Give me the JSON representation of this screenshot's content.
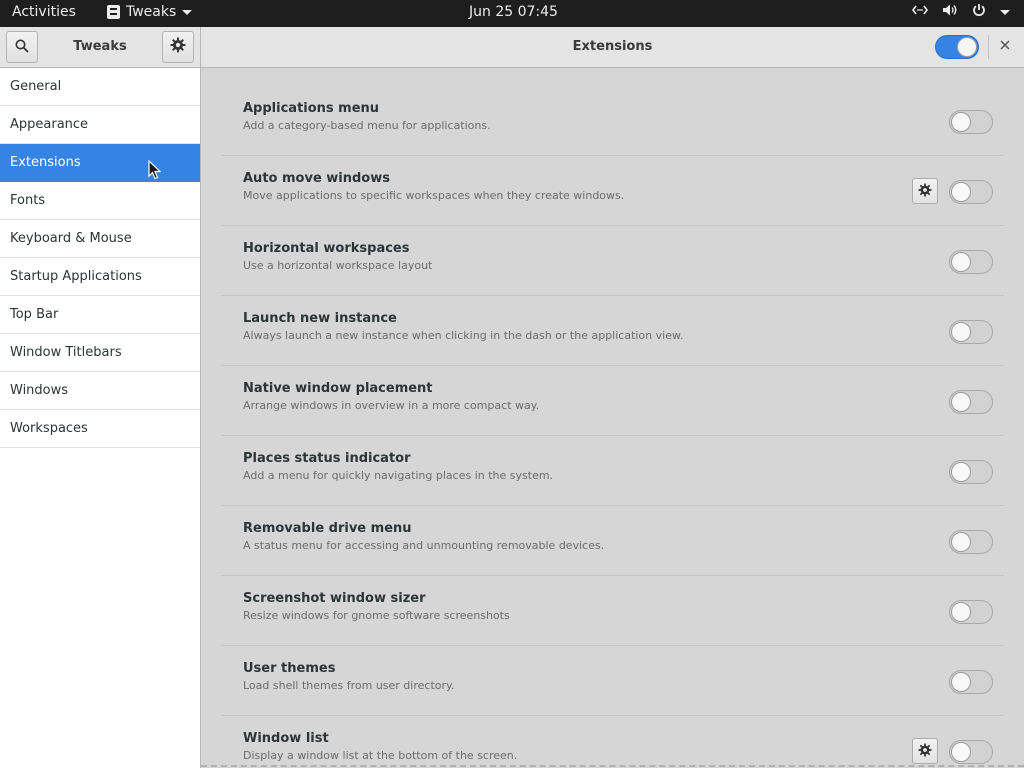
{
  "topbar": {
    "activities": "Activities",
    "app_name": "Tweaks",
    "clock": "Jun 25  07:45"
  },
  "header": {
    "left_title": "Tweaks",
    "main_title": "Extensions",
    "global_switch_on": true
  },
  "sidebar": {
    "items": [
      {
        "label": "General"
      },
      {
        "label": "Appearance"
      },
      {
        "label": "Extensions",
        "active": true
      },
      {
        "label": "Fonts"
      },
      {
        "label": "Keyboard & Mouse"
      },
      {
        "label": "Startup Applications"
      },
      {
        "label": "Top Bar"
      },
      {
        "label": "Window Titlebars"
      },
      {
        "label": "Windows"
      },
      {
        "label": "Workspaces"
      }
    ]
  },
  "extensions": [
    {
      "name": "Applications menu",
      "description": "Add a category-based menu for applications.",
      "has_settings": false,
      "enabled": false
    },
    {
      "name": "Auto move windows",
      "description": "Move applications to specific workspaces when they create windows.",
      "has_settings": true,
      "enabled": false
    },
    {
      "name": "Horizontal workspaces",
      "description": "Use a horizontal workspace layout",
      "has_settings": false,
      "enabled": false
    },
    {
      "name": "Launch new instance",
      "description": "Always launch a new instance when clicking in the dash or the application view.",
      "has_settings": false,
      "enabled": false
    },
    {
      "name": "Native window placement",
      "description": "Arrange windows in overview in a more compact way.",
      "has_settings": false,
      "enabled": false
    },
    {
      "name": "Places status indicator",
      "description": "Add a menu for quickly navigating places in the system.",
      "has_settings": false,
      "enabled": false
    },
    {
      "name": "Removable drive menu",
      "description": "A status menu for accessing and unmounting removable devices.",
      "has_settings": false,
      "enabled": false
    },
    {
      "name": "Screenshot window sizer",
      "description": "Resize windows for gnome software screenshots",
      "has_settings": false,
      "enabled": false
    },
    {
      "name": "User themes",
      "description": "Load shell themes from user directory.",
      "has_settings": false,
      "enabled": false
    },
    {
      "name": "Window list",
      "description": "Display a window list at the bottom of the screen.",
      "has_settings": true,
      "enabled": false
    }
  ],
  "colors": {
    "accent": "#3584e4",
    "topbar_bg": "#1e1e1e",
    "content_bg": "#d6d6d6"
  }
}
